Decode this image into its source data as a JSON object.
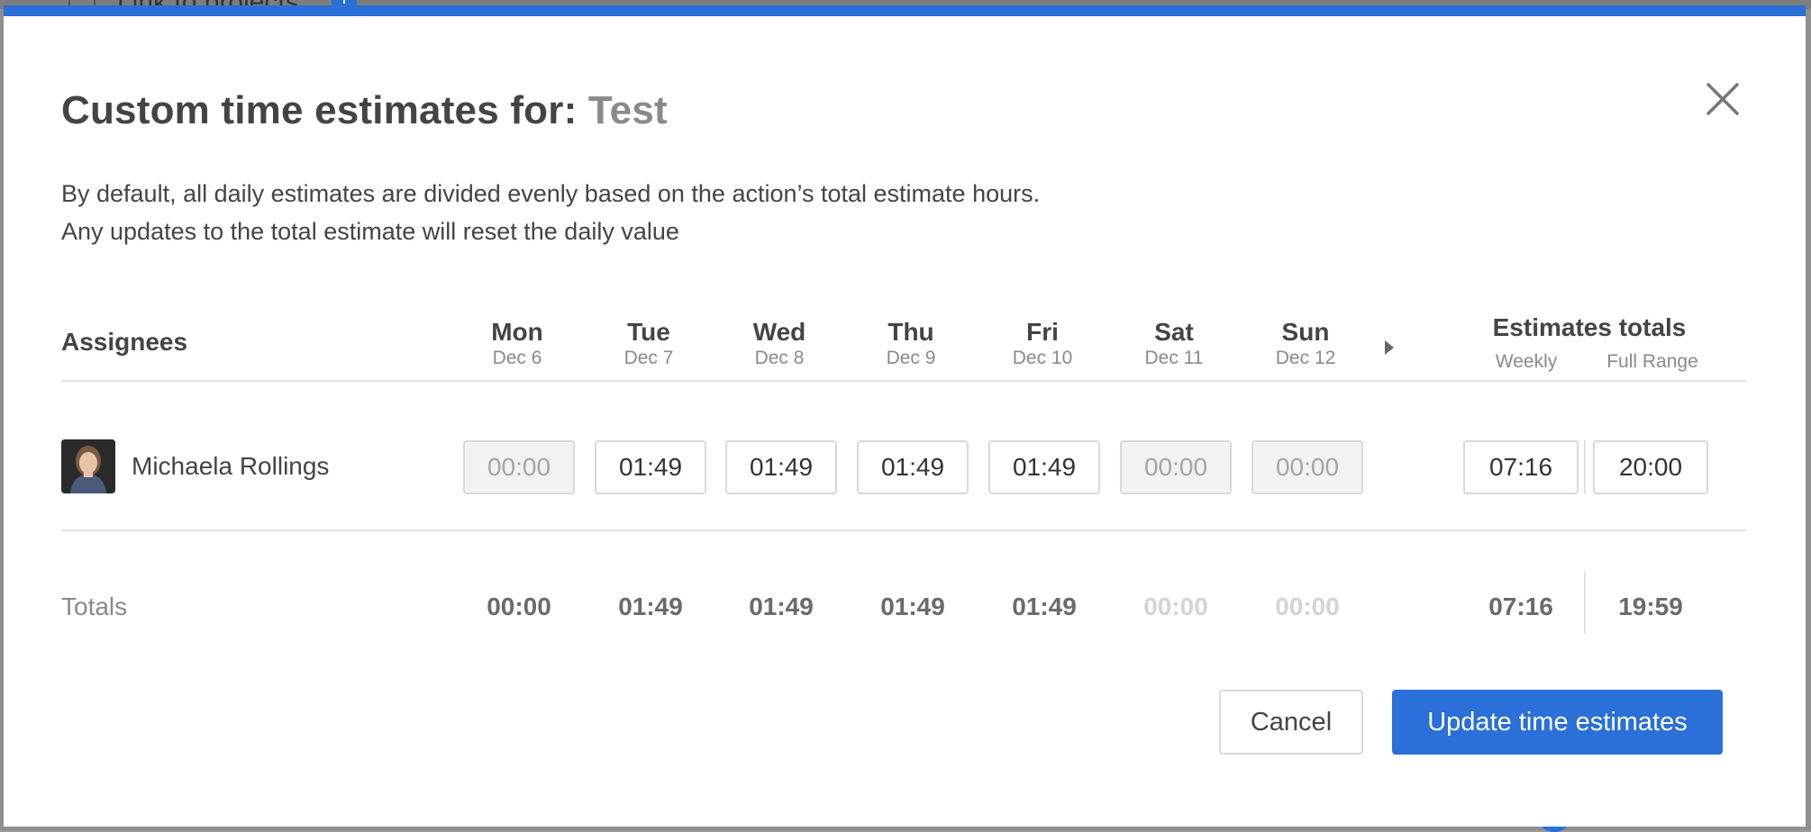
{
  "background": {
    "link_text": "Link to projects",
    "plus_label": "+"
  },
  "modal": {
    "title_prefix": "Custom time estimates for: ",
    "title_name": "Test",
    "description_line1": "By default, all daily estimates are divided evenly based on the action’s total estimate hours.",
    "description_line2": "Any updates to the total estimate will reset the daily value",
    "assignees_header": "Assignees",
    "days": [
      {
        "name": "Mon",
        "date": "Dec 6"
      },
      {
        "name": "Tue",
        "date": "Dec 7"
      },
      {
        "name": "Wed",
        "date": "Dec 8"
      },
      {
        "name": "Thu",
        "date": "Dec 9"
      },
      {
        "name": "Fri",
        "date": "Dec 10"
      },
      {
        "name": "Sat",
        "date": "Dec 11"
      },
      {
        "name": "Sun",
        "date": "Dec 12"
      }
    ],
    "estimates_totals": {
      "title": "Estimates totals",
      "weekly_label": "Weekly",
      "full_range_label": "Full Range"
    },
    "assignee": {
      "name": "Michaela Rollings",
      "daily": [
        "00:00",
        "01:49",
        "01:49",
        "01:49",
        "01:49",
        "00:00",
        "00:00"
      ],
      "weekly": "07:16",
      "full_range": "20:00"
    },
    "totals": {
      "label": "Totals",
      "daily": [
        "00:00",
        "01:49",
        "01:49",
        "01:49",
        "01:49",
        "00:00",
        "00:00"
      ],
      "weekly": "07:16",
      "full_range": "19:59"
    },
    "buttons": {
      "cancel": "Cancel",
      "update": "Update time estimates"
    }
  },
  "colors": {
    "accent": "#2b6fd8",
    "text": "#444444",
    "muted": "#8a8a8a"
  }
}
